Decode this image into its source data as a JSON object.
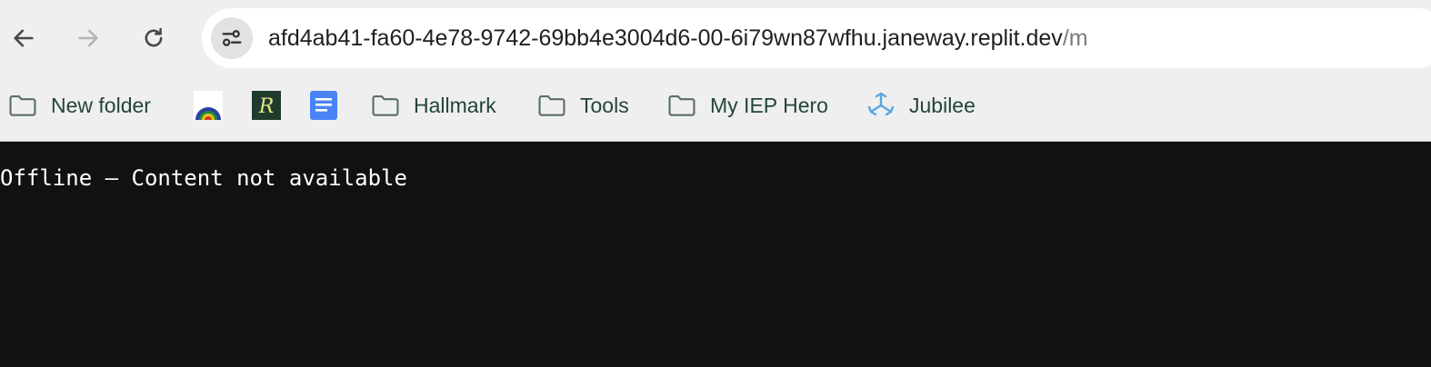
{
  "browser": {
    "url_host": "afd4ab41-fa60-4e78-9742-69bb4e3004d6-00-6i79wn87wfhu.janeway.replit.dev",
    "url_path": "/m"
  },
  "bookmarks": [
    {
      "icon": "folder-icon",
      "label": "New folder"
    },
    {
      "icon": "rainbow-icon",
      "label": ""
    },
    {
      "icon": "r-logo-icon",
      "label": ""
    },
    {
      "icon": "google-docs-icon",
      "label": ""
    },
    {
      "icon": "folder-icon",
      "label": "Hallmark"
    },
    {
      "icon": "folder-icon",
      "label": "Tools"
    },
    {
      "icon": "folder-icon",
      "label": "My IEP Hero"
    },
    {
      "icon": "jubilee-logo-icon",
      "label": "Jubilee"
    }
  ],
  "page": {
    "message": "Offline – Content not available"
  },
  "colors": {
    "chrome_bg": "#efefef",
    "page_bg": "#111111",
    "bookmark_text": "#24443a",
    "url_path": "#7a7a7a"
  }
}
